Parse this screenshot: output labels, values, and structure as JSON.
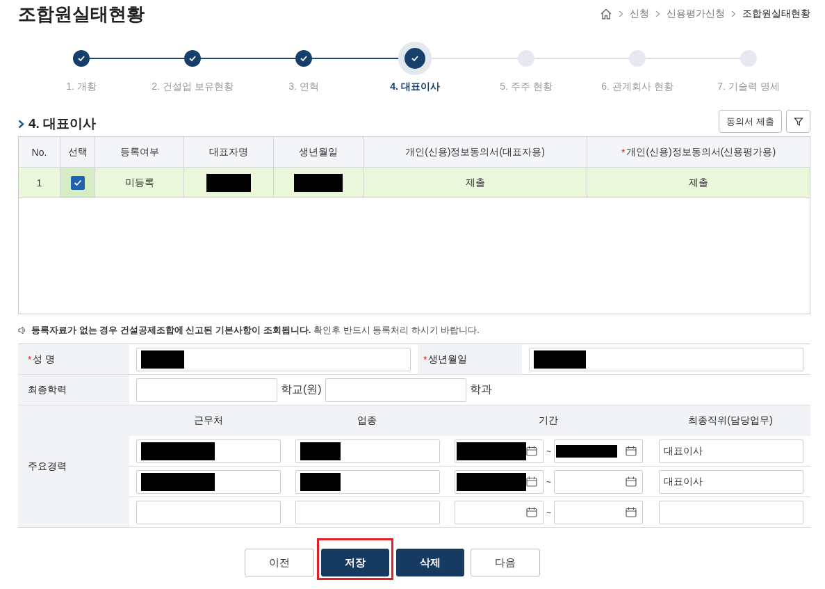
{
  "page": {
    "title": "조합원실태현황"
  },
  "breadcrumb": [
    "신청",
    "신용평가신청",
    "조합원실태현황"
  ],
  "steps": [
    {
      "label": "1. 개황",
      "done": true,
      "current": false
    },
    {
      "label": "2. 건설업 보유현황",
      "done": true,
      "current": false
    },
    {
      "label": "3. 연혁",
      "done": true,
      "current": false
    },
    {
      "label": "4. 대표이사",
      "done": true,
      "current": true
    },
    {
      "label": "5. 주주 현황",
      "done": false,
      "current": false
    },
    {
      "label": "6. 관계회사 현황",
      "done": false,
      "current": false
    },
    {
      "label": "7. 기술력 명세",
      "done": false,
      "current": false
    }
  ],
  "section": {
    "title": "4. 대표이사",
    "consent_button": "동의서 제출"
  },
  "table": {
    "columns": [
      {
        "label": "No.",
        "required": false
      },
      {
        "label": "선택",
        "required": false
      },
      {
        "label": "등록여부",
        "required": false
      },
      {
        "label": "대표자명",
        "required": false
      },
      {
        "label": "생년월일",
        "required": false
      },
      {
        "label": "개인(신용)정보동의서(대표자용)",
        "required": false
      },
      {
        "label": "개인(신용)정보동의서(신용평가용)",
        "required": true,
        "required_mark": "*"
      }
    ],
    "rows": [
      {
        "no": "1",
        "checked": true,
        "selected": true,
        "status": "미등록",
        "name_redacted": true,
        "birth_redacted": true,
        "consent_rep": "제출",
        "consent_credit": "제출"
      }
    ]
  },
  "notice": "**등록자료가 없는 경우 건설공제조합에 신고된 기본사항이 조회됩니다.** 확인후 반드시 등록처리 하시기 바랍니다.",
  "form": {
    "name": {
      "label": "성 명",
      "required": true,
      "required_mark": "*",
      "redacted": true
    },
    "birth": {
      "label": "생년월일",
      "required": true,
      "required_mark": "*",
      "redacted": true
    },
    "education": {
      "label": "최종학력",
      "school_suffix": "학교(원)",
      "major_suffix": "학과"
    },
    "career": {
      "label": "주요경력",
      "columns": [
        "근무처",
        "업종",
        "기간",
        "최종직위(담당업무)"
      ],
      "separator": "~",
      "rows": [
        {
          "workplace_redacted": true,
          "industry_redacted": true,
          "start_redacted": true,
          "end_redacted": true,
          "position": "대표이사"
        },
        {
          "workplace_redacted": true,
          "industry_redacted": true,
          "start_redacted": true,
          "end_redacted": false,
          "position": "대표이사"
        },
        {
          "workplace_redacted": false,
          "industry_redacted": false,
          "start_redacted": false,
          "end_redacted": false,
          "position": ""
        }
      ]
    }
  },
  "buttons": [
    {
      "label": "이전",
      "kind": "secondary",
      "highlighted": false
    },
    {
      "label": "저장",
      "kind": "primary",
      "highlighted": true
    },
    {
      "label": "삭제",
      "kind": "primary",
      "highlighted": false
    },
    {
      "label": "다음",
      "kind": "secondary",
      "highlighted": false
    }
  ]
}
